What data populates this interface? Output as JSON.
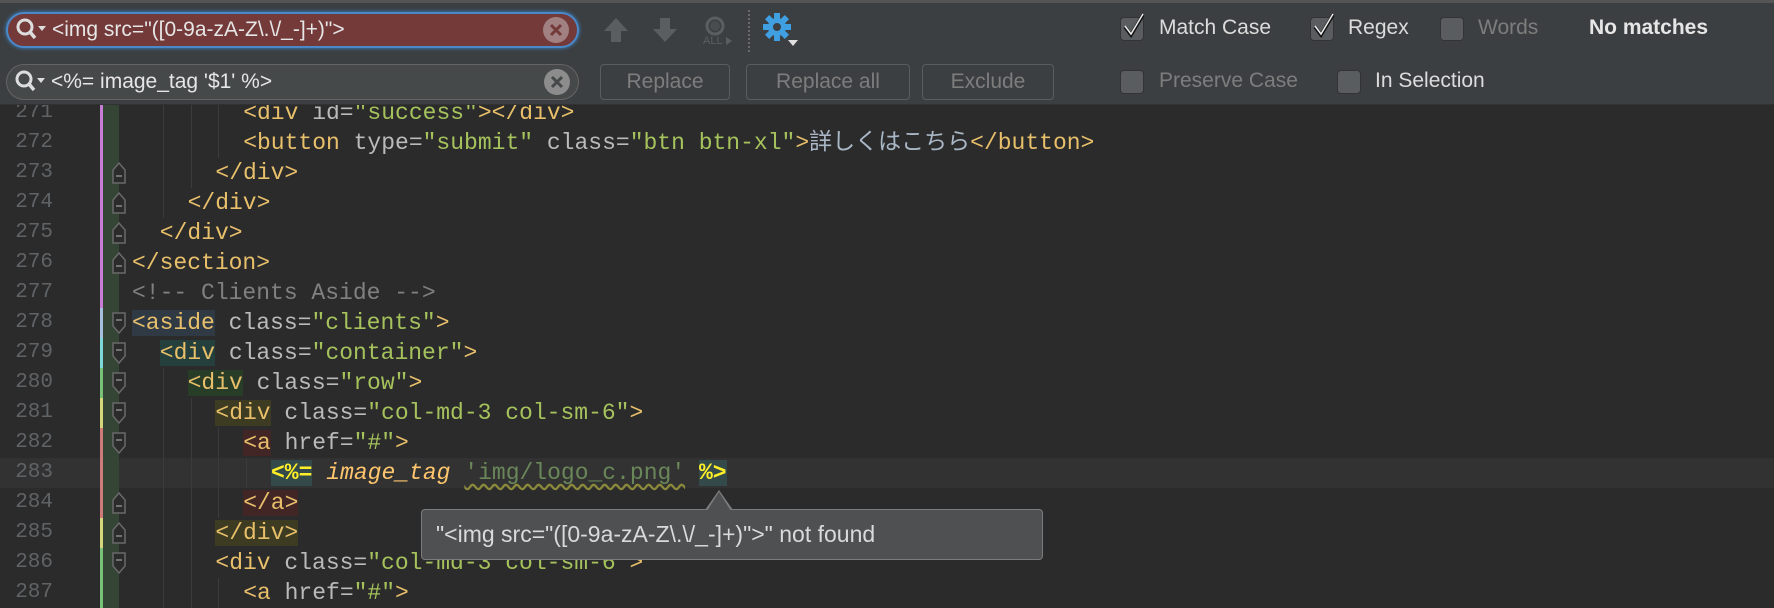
{
  "find_bar": {
    "search_value": "<img src=\"([0-9a-zA-Z\\.\\/_-]+)\">",
    "replace_value": "<%= image_tag '$1' %>",
    "search_state_color": "#743a3a",
    "icons": [
      "search-history-icon",
      "clear-icon",
      "previous-occurrence-icon",
      "next-occurrence-icon",
      "find-all-icon",
      "settings-gear-icon"
    ],
    "accent_color": "#3f9fe0",
    "buttons": {
      "replace": "Replace",
      "replace_all": "Replace all",
      "exclude": "Exclude"
    },
    "options": {
      "match_case": {
        "label": "Match Case",
        "checked": true
      },
      "regex": {
        "label": "Regex",
        "checked": true
      },
      "words": {
        "label": "Words",
        "checked": false
      },
      "preserve_case": {
        "label": "Preserve Case",
        "checked": false
      },
      "in_selection": {
        "label": "In Selection",
        "checked": false
      }
    },
    "status": "No matches"
  },
  "editor": {
    "current_line": 283,
    "lines": [
      {
        "n": "271",
        "indent": 8,
        "stripe": "#c77dd4",
        "tokens": [
          {
            "t": "<div ",
            "c": "tag"
          },
          {
            "t": "id=",
            "c": "attr"
          },
          {
            "t": "\"success\"",
            "c": "val"
          },
          {
            "t": "></div>",
            "c": "tag"
          }
        ]
      },
      {
        "n": "272",
        "indent": 8,
        "stripe": "#c77dd4",
        "tokens": [
          {
            "t": "<button ",
            "c": "tag"
          },
          {
            "t": "type=",
            "c": "attr"
          },
          {
            "t": "\"submit\" ",
            "c": "val"
          },
          {
            "t": "class=",
            "c": "attr"
          },
          {
            "t": "\"btn btn-xl\"",
            "c": "val"
          },
          {
            "t": ">",
            "c": "tag"
          },
          {
            "t": "詳しくはこちら",
            "c": "txt"
          },
          {
            "t": "</button>",
            "c": "tag"
          }
        ]
      },
      {
        "n": "273",
        "indent": 6,
        "stripe": "#c77dd4",
        "fold": "end",
        "tokens": [
          {
            "t": "</div>",
            "c": "tag"
          }
        ]
      },
      {
        "n": "274",
        "indent": 4,
        "stripe": "#c77dd4",
        "fold": "end",
        "tokens": [
          {
            "t": "</div>",
            "c": "tag"
          }
        ]
      },
      {
        "n": "275",
        "indent": 2,
        "stripe": "#c77dd4",
        "fold": "end",
        "tokens": [
          {
            "t": "</div>",
            "c": "tag"
          }
        ]
      },
      {
        "n": "276",
        "indent": 0,
        "stripe": "#c77dd4",
        "fold": "end",
        "tokens": [
          {
            "t": "</section>",
            "c": "tag"
          }
        ]
      },
      {
        "n": "277",
        "indent": 0,
        "stripe": "#c77dd4",
        "tokens": [
          {
            "t": "<!-- Clients Aside -->",
            "c": "cmt"
          }
        ]
      },
      {
        "n": "278",
        "indent": 0,
        "stripe": "#a5bfdc",
        "fold": "start",
        "tokens": [
          {
            "t": "<aside",
            "c": "tag",
            "hl": "blue"
          },
          {
            "t": " class=",
            "c": "attr"
          },
          {
            "t": "\"clients\"",
            "c": "val"
          },
          {
            "t": ">",
            "c": "tag"
          }
        ]
      },
      {
        "n": "279",
        "indent": 2,
        "stripe": "#7dd8d8",
        "fold": "start",
        "tokens": [
          {
            "t": "<div",
            "c": "tag",
            "hl": "teal"
          },
          {
            "t": " class=",
            "c": "attr"
          },
          {
            "t": "\"container\"",
            "c": "val"
          },
          {
            "t": ">",
            "c": "tag"
          }
        ]
      },
      {
        "n": "280",
        "indent": 4,
        "stripe": "#79c27a",
        "fold": "start",
        "tokens": [
          {
            "t": "<div",
            "c": "tag",
            "hl": "green"
          },
          {
            "t": " class=",
            "c": "attr"
          },
          {
            "t": "\"row\"",
            "c": "val"
          },
          {
            "t": ">",
            "c": "tag"
          }
        ]
      },
      {
        "n": "281",
        "indent": 6,
        "stripe": "#d6d67a",
        "fold": "start",
        "tokens": [
          {
            "t": "<div",
            "c": "tag",
            "hl": "olive"
          },
          {
            "t": " class=",
            "c": "attr"
          },
          {
            "t": "\"col-md-3 col-sm-6\"",
            "c": "val"
          },
          {
            "t": ">",
            "c": "tag"
          }
        ]
      },
      {
        "n": "282",
        "indent": 8,
        "stripe": "#d07a7a",
        "fold": "start",
        "tokens": [
          {
            "t": "<a",
            "c": "tag",
            "hl": "red"
          },
          {
            "t": " href=",
            "c": "attr"
          },
          {
            "t": "\"#\"",
            "c": "val"
          },
          {
            "t": ">",
            "c": "tag"
          }
        ]
      },
      {
        "n": "283",
        "indent": 10,
        "stripe": "#d07a7a",
        "tokens": [
          {
            "t": "<%=",
            "c": "erb",
            "hl": "erb"
          },
          {
            "t": " ",
            "c": "txt"
          },
          {
            "t": "image_tag",
            "c": "meth"
          },
          {
            "t": " ",
            "c": "txt"
          },
          {
            "t": "'img/logo_c.png'",
            "c": "str"
          },
          {
            "t": " ",
            "c": "txt"
          },
          {
            "t": "%>",
            "c": "erb",
            "hl": "erb"
          }
        ]
      },
      {
        "n": "284",
        "indent": 8,
        "stripe": "#d07a7a",
        "fold": "end",
        "tokens": [
          {
            "t": "</a>",
            "c": "tag",
            "hl": "red"
          }
        ]
      },
      {
        "n": "285",
        "indent": 6,
        "stripe": "#d6d67a",
        "fold": "end",
        "tokens": [
          {
            "t": "</div>",
            "c": "tag",
            "hl": "olive"
          }
        ]
      },
      {
        "n": "286",
        "indent": 6,
        "stripe": "#79c27a",
        "fold": "start",
        "tokens": [
          {
            "t": "<div ",
            "c": "tag"
          },
          {
            "t": "class=",
            "c": "attr"
          },
          {
            "t": "\"col-md-3 col-sm-6\"",
            "c": "val"
          },
          {
            "t": ">",
            "c": "tag"
          }
        ]
      },
      {
        "n": "287",
        "indent": 8,
        "stripe": "#79c27a",
        "tokens": [
          {
            "t": "<a ",
            "c": "tag"
          },
          {
            "t": "href=",
            "c": "attr"
          },
          {
            "t": "\"#\"",
            "c": "val"
          },
          {
            "t": ">",
            "c": "tag"
          }
        ]
      }
    ]
  },
  "tooltip": {
    "text": "\"<img src=\"([0-9a-zA-Z\\.\\/_-]+)\">\" not found"
  }
}
